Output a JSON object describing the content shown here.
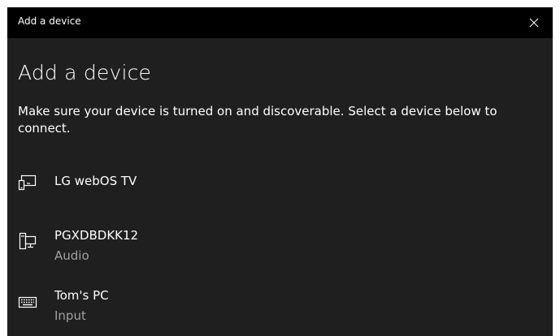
{
  "window": {
    "title": "Add a device",
    "close_icon": "close-icon"
  },
  "main": {
    "heading": "Add a device",
    "instruction": "Make sure your device is turned on and discoverable. Select a device below to connect."
  },
  "devices": [
    {
      "name": "LG webOS TV",
      "type": "",
      "icon": "tv-icon"
    },
    {
      "name": "PGXDBDKK12",
      "type": "Audio",
      "icon": "computer-icon"
    },
    {
      "name": "Tom's PC",
      "type": "Input",
      "icon": "keyboard-icon"
    }
  ],
  "colors": {
    "window_background": "#1f1f1f",
    "titlebar_background": "#000000",
    "text": "#ffffff",
    "secondary_text": "#a0a0a0"
  }
}
